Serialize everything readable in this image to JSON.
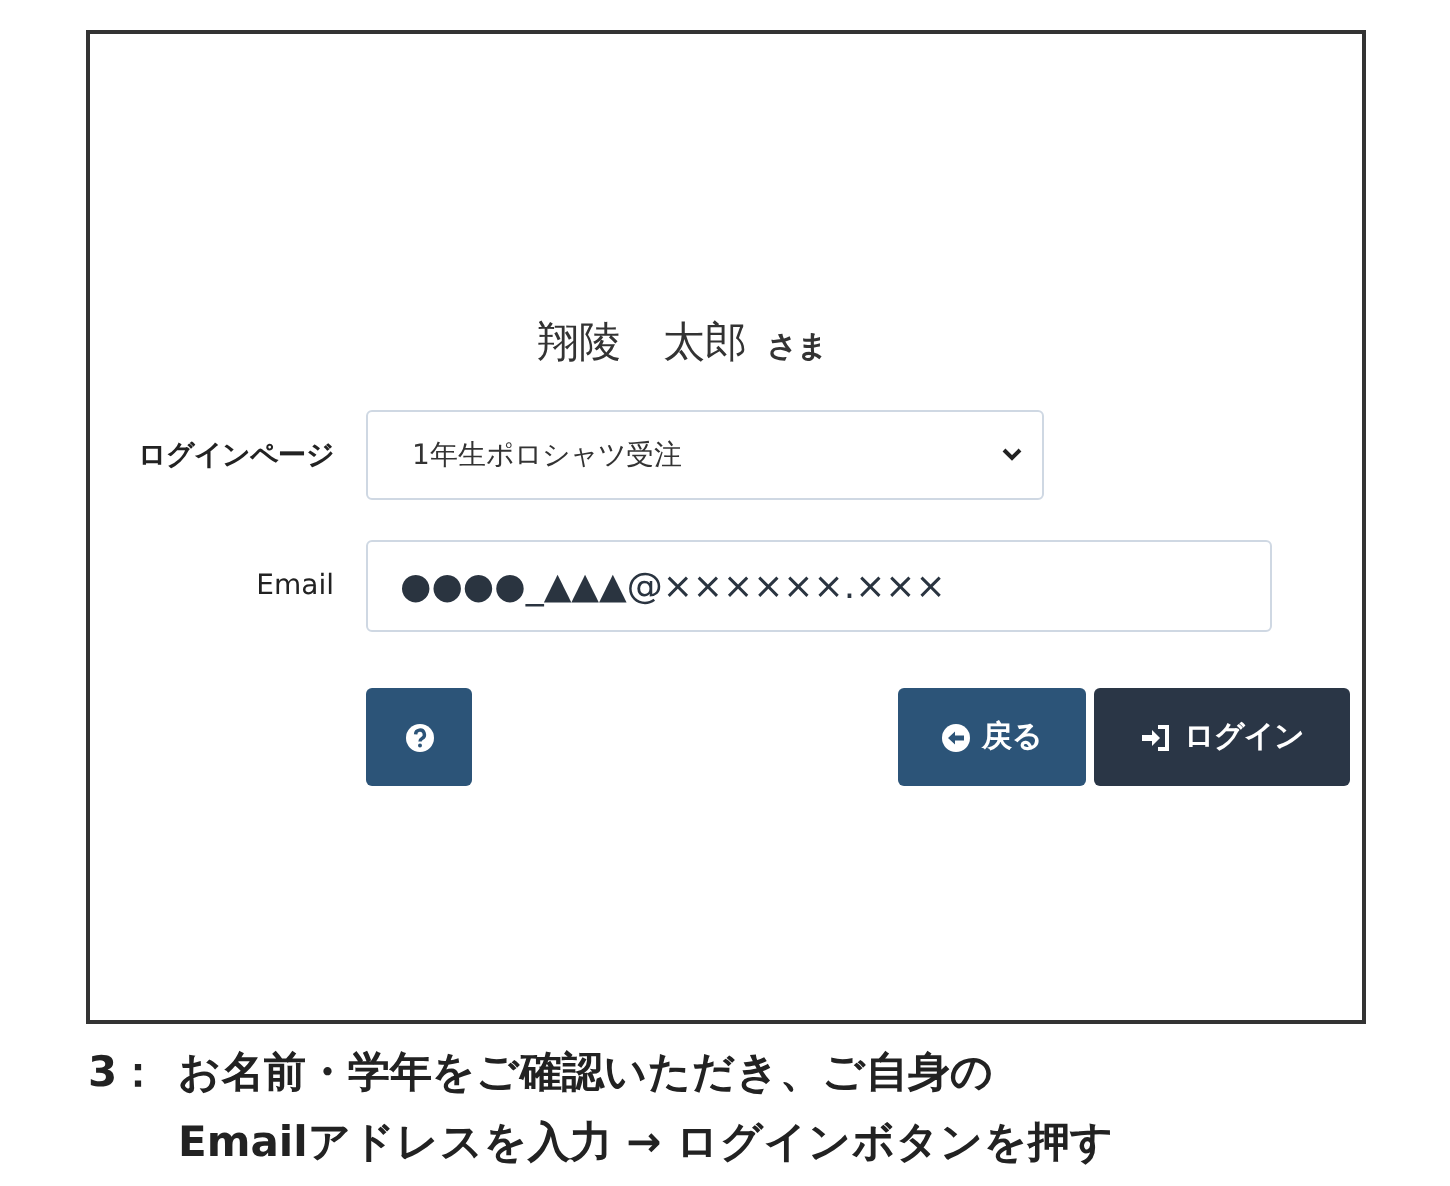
{
  "user": {
    "name": "翔陵　太郎",
    "honorific": "さま"
  },
  "login_page": {
    "label": "ログインページ",
    "value": "1年生ポロシャツ受注"
  },
  "email": {
    "label": "Email",
    "value": "●●●●_▲▲▲@××××××.×××"
  },
  "buttons": [
    {
      "kind": "help"
    },
    {
      "kind": "back",
      "label": "戻る"
    },
    {
      "kind": "login",
      "label": "ログイン"
    }
  ],
  "caption": {
    "number": "3：",
    "lines": [
      "お名前・学年をご確認いただき、ご自身の",
      "Emailアドレスを入力 → ログインボタンを押す"
    ]
  }
}
